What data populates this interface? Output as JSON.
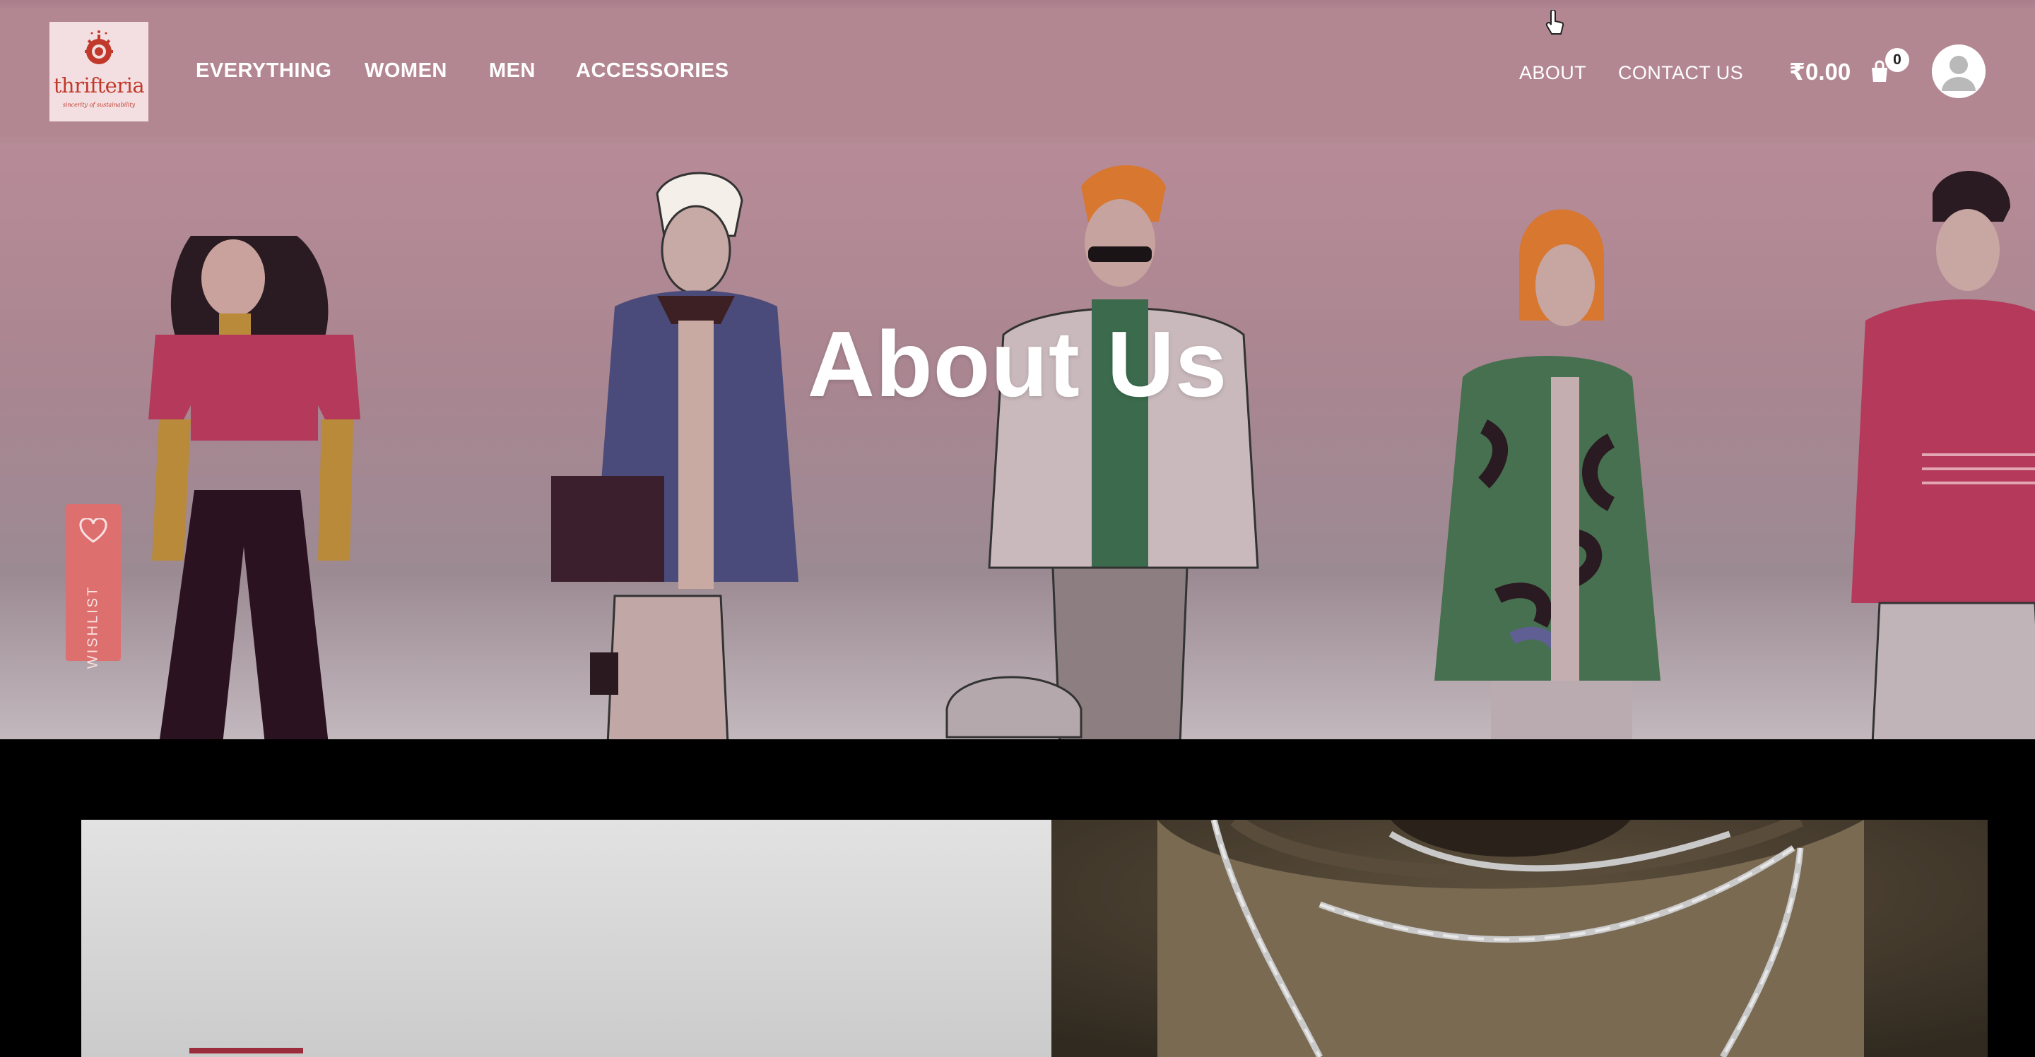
{
  "logo": {
    "brand": "thrifteria",
    "tagline": "sincerity of sustainability",
    "icon": "logo-emblem-icon"
  },
  "nav": {
    "main": [
      "EVERYTHING",
      "WOMEN",
      "MEN",
      "ACCESSORIES"
    ],
    "about": "ABOUT",
    "contact": "CONTACT US"
  },
  "cart": {
    "price": "₹0.00",
    "count": "0",
    "icon": "shopping-bag-icon"
  },
  "account": {
    "icon": "user-avatar-icon"
  },
  "hero": {
    "title": "About Us"
  },
  "wishlist": {
    "label": "WISHLIST",
    "icon": "heart-icon"
  },
  "colors": {
    "header": "#b38791",
    "accent": "#9b2c3b",
    "wishlist": "#dd6f6f",
    "brand": "#c0392b"
  }
}
